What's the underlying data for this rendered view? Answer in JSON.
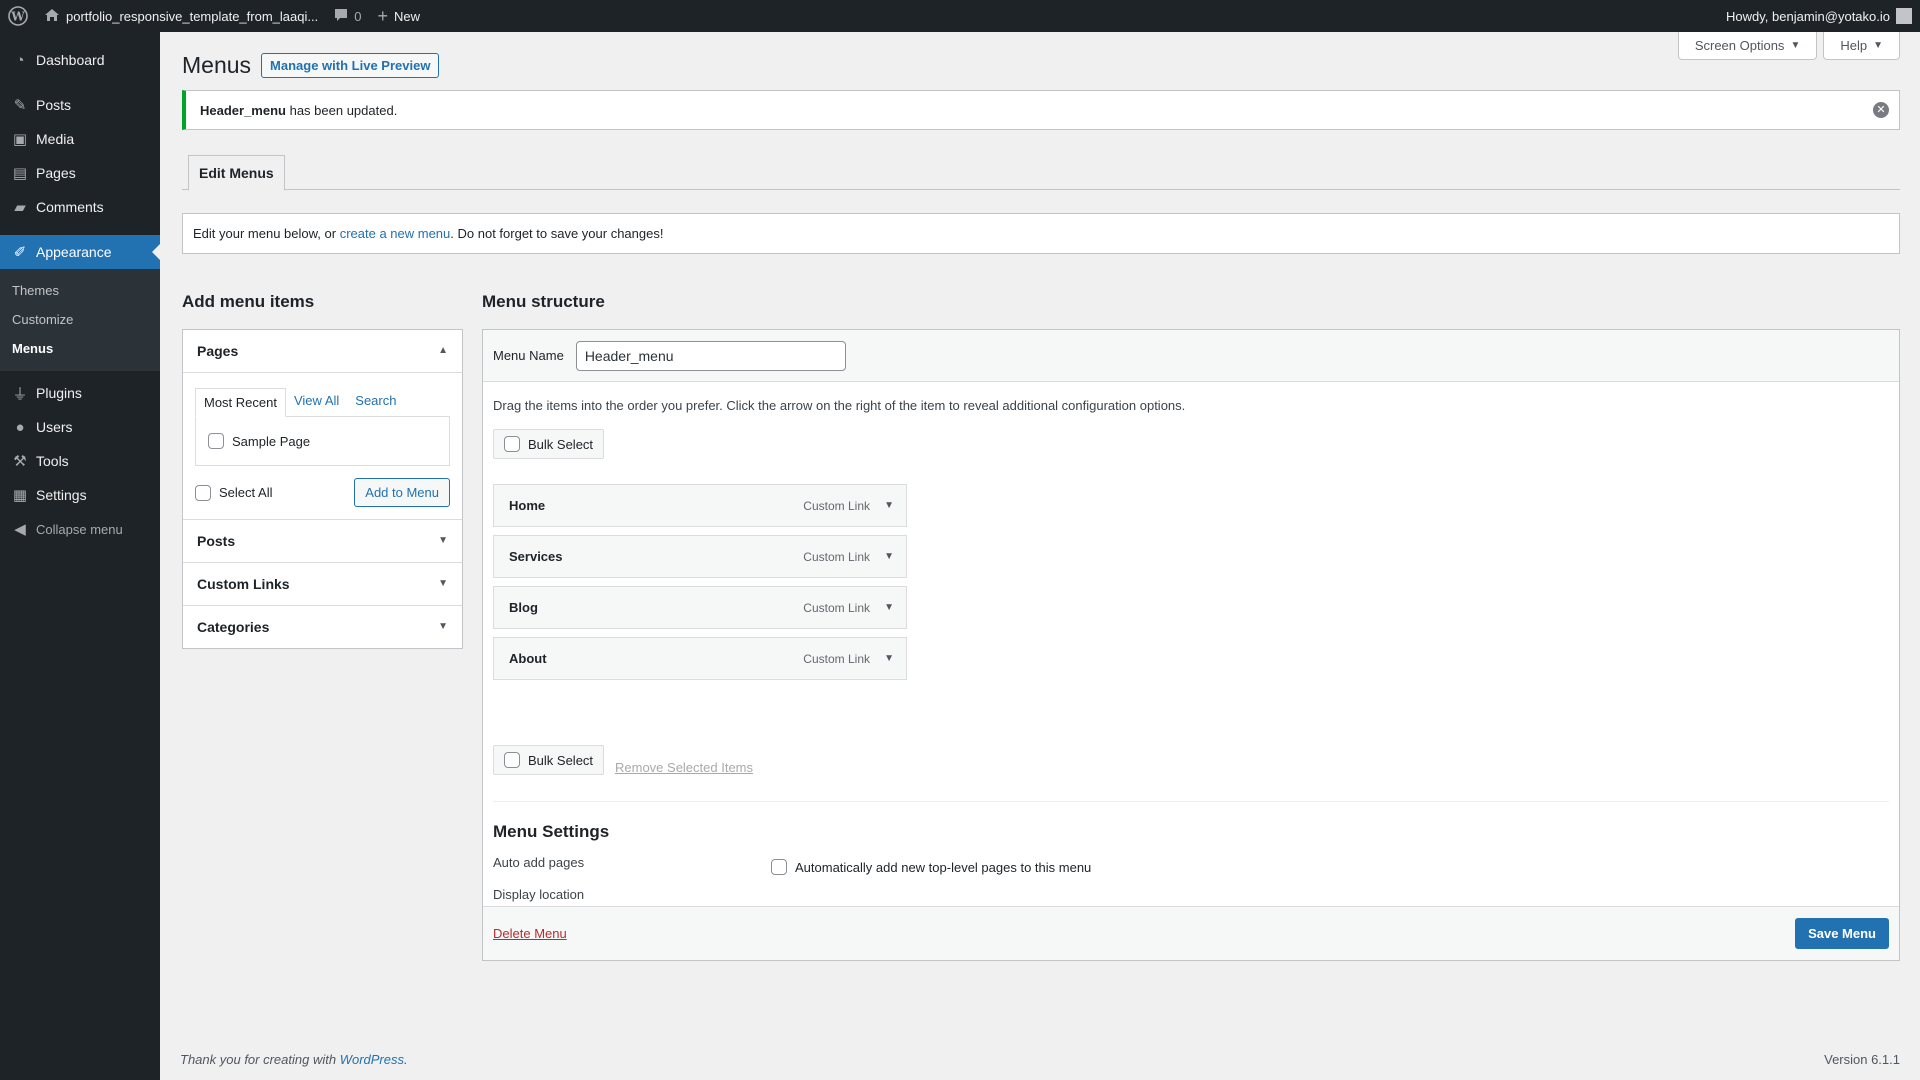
{
  "admin_bar": {
    "wp_logo_icon": "wordpress-logo-icon",
    "site_name": "portfolio_responsive_template_from_laaqi...",
    "comments_count": "0",
    "new_label": "New",
    "howdy": "Howdy, benjamin@yotako.io"
  },
  "sidebar": {
    "items": [
      {
        "label": "Dashboard",
        "icon": "dashboard-icon"
      },
      {
        "label": "Posts",
        "icon": "pin-icon"
      },
      {
        "label": "Media",
        "icon": "media-icon"
      },
      {
        "label": "Pages",
        "icon": "page-icon"
      },
      {
        "label": "Comments",
        "icon": "comment-icon"
      },
      {
        "label": "Appearance",
        "icon": "brush-icon"
      },
      {
        "label": "Plugins",
        "icon": "plug-icon"
      },
      {
        "label": "Users",
        "icon": "user-icon"
      },
      {
        "label": "Tools",
        "icon": "wrench-icon"
      },
      {
        "label": "Settings",
        "icon": "settings-icon"
      },
      {
        "label": "Collapse menu",
        "icon": "collapse-icon"
      }
    ],
    "submenu": [
      "Themes",
      "Customize",
      "Menus"
    ]
  },
  "header": {
    "title": "Menus",
    "live_preview_label": "Manage with Live Preview",
    "screen_options": "Screen Options",
    "help": "Help"
  },
  "notice": {
    "menu_name": "Header_menu",
    "text": " has been updated."
  },
  "tabs": {
    "edit_menus": "Edit Menus"
  },
  "manage": {
    "before": "Edit your menu below, or ",
    "link": "create a new menu",
    "after": ". Do not forget to save your changes!"
  },
  "add_items": {
    "heading": "Add menu items",
    "pages_title": "Pages",
    "tabs": [
      "Most Recent",
      "View All",
      "Search"
    ],
    "sample_page": "Sample Page",
    "select_all": "Select All",
    "add_button": "Add to Menu",
    "posts_title": "Posts",
    "custom_links_title": "Custom Links",
    "categories_title": "Categories"
  },
  "structure": {
    "heading": "Menu structure",
    "menu_name_label": "Menu Name",
    "menu_name_value": "Header_menu",
    "instructions": "Drag the items into the order you prefer. Click the arrow on the right of the item to reveal additional configuration options.",
    "bulk_select": "Bulk Select",
    "items": [
      {
        "title": "Home",
        "type": "Custom Link"
      },
      {
        "title": "Services",
        "type": "Custom Link"
      },
      {
        "title": "Blog",
        "type": "Custom Link"
      },
      {
        "title": "About",
        "type": "Custom Link"
      }
    ],
    "remove_selected": "Remove Selected Items",
    "settings_title": "Menu Settings",
    "auto_add_label": "Auto add pages",
    "auto_add_option": "Automatically add new top-level pages to this menu",
    "display_location_label": "Display location",
    "delete_menu": "Delete Menu",
    "save_menu": "Save Menu"
  },
  "footer": {
    "thanks_before": "Thank you for creating with ",
    "thanks_link": "WordPress",
    "thanks_after": ".",
    "version": "Version 6.1.1"
  },
  "colors": {
    "accent": "#2271b1",
    "admin_bar": "#1d2327",
    "notice_success": "#00a32a",
    "danger": "#b32d2e"
  }
}
